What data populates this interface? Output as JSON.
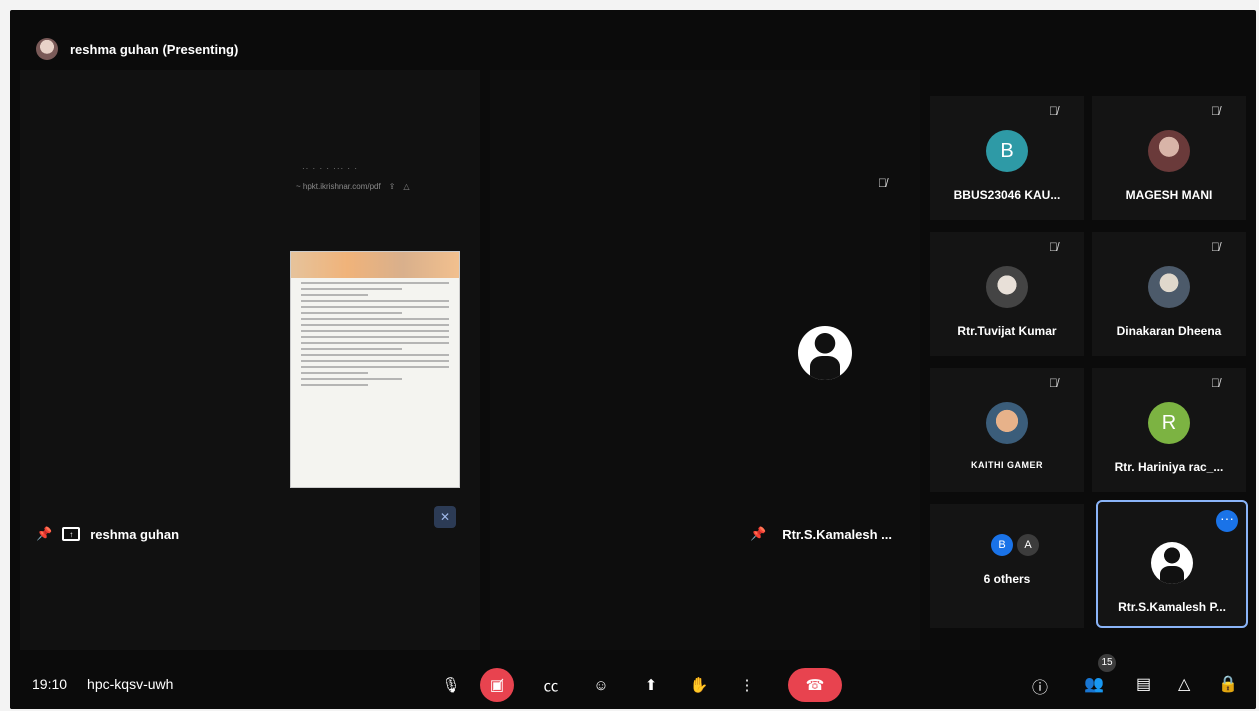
{
  "presenter": {
    "label": "reshma guhan (Presenting)",
    "tile_name": "reshma guhan"
  },
  "phone_bar": {
    "status": "·· · · ·      ··· · ·",
    "url": "~ hpkt.ikrishnar.com/pdf"
  },
  "pinned": {
    "name": "Rtr.S.Kamalesh ..."
  },
  "participants": [
    {
      "name": "BBUS23046 KAU...",
      "initial": "B",
      "color": "#2e9aa6",
      "muted": true
    },
    {
      "name": "MAGESH MANI",
      "initial": "",
      "muted": true
    },
    {
      "name": "Rtr.Tuvijat Kumar",
      "initial": "",
      "muted": true
    },
    {
      "name": "Dinakaran Dheena",
      "initial": "",
      "muted": true
    },
    {
      "name": "KAITHI GAMER",
      "initial": "",
      "muted": true
    },
    {
      "name": "Rtr. Hariniya rac_...",
      "initial": "R",
      "color": "#7cb342",
      "muted": true
    }
  ],
  "others": {
    "label": "6 others",
    "initials": [
      "B",
      "A"
    ],
    "colors": [
      "#1a73e8",
      "#3c3c3c"
    ]
  },
  "active_speaker": {
    "name": "Rtr.S.Kamalesh P..."
  },
  "meeting": {
    "time": "19:10",
    "code": "hpc-kqsv-uwh",
    "participant_count": "15"
  },
  "icons": {
    "mic": "mic-icon",
    "camera_off": "camera-off-icon",
    "captions": "captions-icon",
    "emoji": "emoji-icon",
    "present": "present-icon",
    "raise_hand": "hand-icon",
    "more": "more-icon",
    "leave": "phone-hangup-icon",
    "info": "info-icon",
    "people": "people-icon",
    "chat": "chat-icon",
    "activities": "activities-icon",
    "lock": "lock-icon"
  },
  "colors": {
    "danger": "#e8434f",
    "accent": "#8ab4f8",
    "background": "#0b0b0b"
  }
}
